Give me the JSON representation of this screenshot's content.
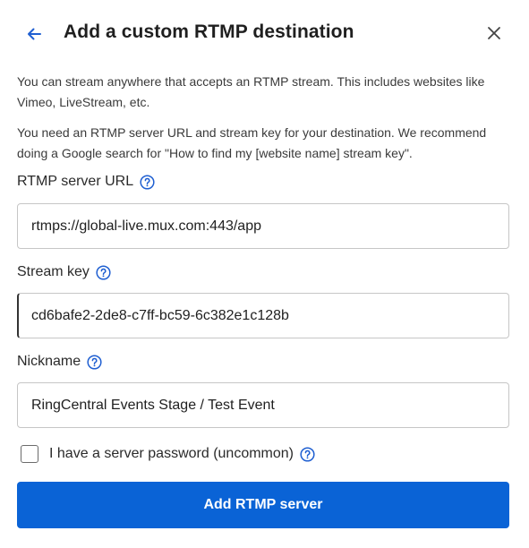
{
  "header": {
    "title": "Add a custom RTMP destination",
    "back_icon": "arrow-left-icon",
    "close_icon": "close-icon"
  },
  "intro": {
    "line1": "You can stream anywhere that accepts an RTMP stream. This includes websites like Vimeo, LiveStream, etc.",
    "line2": "You need an RTMP server URL and stream key for your destination. We recommend doing a Google search for \"How to find my [website name] stream key\"."
  },
  "form": {
    "server_url": {
      "label": "RTMP server URL",
      "value": "rtmps://global-live.mux.com:443/app"
    },
    "stream_key": {
      "label": "Stream key",
      "value": "cd6bafe2-2de8-c7ff-bc59-6c382e1c128b"
    },
    "nickname": {
      "label": "Nickname",
      "value": "RingCentral Events Stage / Test Event"
    },
    "server_password": {
      "label": "I have a server password (uncommon)",
      "checked": false
    }
  },
  "submit_label": "Add RTMP server",
  "colors": {
    "accent": "#0a63d6",
    "help_icon": "#1f5fd1"
  }
}
